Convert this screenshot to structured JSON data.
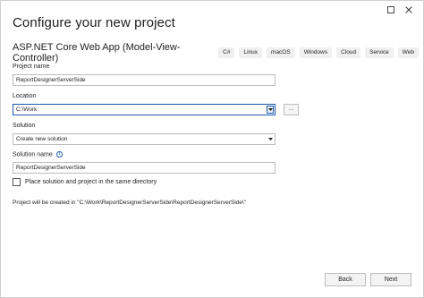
{
  "window": {
    "title": "Configure your new project",
    "controls": [
      "maximize-icon",
      "close-icon"
    ]
  },
  "template": {
    "name": "ASP.NET Core Web App (Model-View-Controller)",
    "tags": [
      "C#",
      "Linux",
      "macOS",
      "Windows",
      "Cloud",
      "Service",
      "Web"
    ]
  },
  "project_name": {
    "label": "Project name",
    "value": "ReportDesignerServerSide"
  },
  "location": {
    "label": "Location",
    "value": "C:\\Work",
    "browse_label": "..."
  },
  "solution": {
    "label": "Solution",
    "selected": "Create new solution"
  },
  "solution_name": {
    "label": "Solution name",
    "info_icon": "i",
    "value": "ReportDesignerServerSide"
  },
  "same_directory": {
    "label": "Place solution and project in the same directory",
    "checked": false
  },
  "created_path": "Project will be created in \"C:\\Work\\ReportDesignerServerSide\\ReportDesignerServerSide\\\"",
  "footer": {
    "back_label": "Back",
    "next_label": "Next"
  }
}
